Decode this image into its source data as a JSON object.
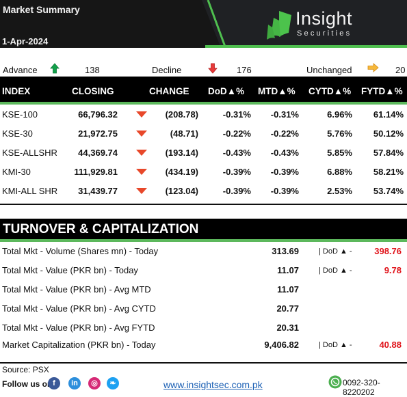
{
  "header": {
    "title": "Market Summary",
    "date": "1-Apr-2024",
    "brand_name": "Insight",
    "brand_sub": "Securities",
    "accent_color": "#4fbf4f"
  },
  "breadth": {
    "advance_label": "Advance",
    "advance_icon": "arrow-up-icon",
    "advance_value": "138",
    "decline_label": "Decline",
    "decline_icon": "arrow-down-icon",
    "decline_value": "176",
    "unchanged_label": "Unchanged",
    "unchanged_icon": "arrow-right-icon",
    "unchanged_value": "20"
  },
  "index_table": {
    "headers": [
      "INDEX",
      "CLOSING",
      "CHANGE",
      "DoD▲%",
      "MTD▲%",
      "CYTD▲%",
      "FYTD▲%"
    ],
    "rows": [
      {
        "index": "KSE-100",
        "closing": "66,796.32",
        "direction": "down",
        "change": "(208.78)",
        "dod": "-0.31%",
        "mtd": "-0.31%",
        "cytd": "6.96%",
        "fytd": "61.14%"
      },
      {
        "index": "KSE-30",
        "closing": "21,972.75",
        "direction": "down",
        "change": "(48.71)",
        "dod": "-0.22%",
        "mtd": "-0.22%",
        "cytd": "5.76%",
        "fytd": "50.12%"
      },
      {
        "index": "KSE-ALLSHR",
        "closing": "44,369.74",
        "direction": "down",
        "change": "(193.14)",
        "dod": "-0.43%",
        "mtd": "-0.43%",
        "cytd": "5.85%",
        "fytd": "57.84%"
      },
      {
        "index": "KMI-30",
        "closing": "111,929.81",
        "direction": "down",
        "change": "(434.19)",
        "dod": "-0.39%",
        "mtd": "-0.39%",
        "cytd": "6.88%",
        "fytd": "58.21%"
      },
      {
        "index": "KMI-ALL SHR",
        "closing": "31,439.77",
        "direction": "down",
        "change": "(123.04)",
        "dod": "-0.39%",
        "mtd": "-0.39%",
        "cytd": "2.53%",
        "fytd": "53.74%"
      }
    ]
  },
  "turnover": {
    "title": "TURNOVER & CAPITALIZATION",
    "rows": [
      {
        "label": "Total Mkt - Volume (Shares mn) - Today",
        "value": "313.69",
        "dod_label": "| DoD ▲  -",
        "dod_value": "398.76"
      },
      {
        "label": "Total Mkt - Value (PKR bn) - Today",
        "value": "11.07",
        "dod_label": "| DoD ▲  -",
        "dod_value": "9.78"
      },
      {
        "label": "Total Mkt - Value (PKR bn) - Avg MTD",
        "value": "11.07",
        "dod_label": "",
        "dod_value": ""
      },
      {
        "label": "Total Mkt - Value (PKR bn) - Avg CYTD",
        "value": "20.77",
        "dod_label": "",
        "dod_value": ""
      },
      {
        "label": "Total Mkt - Value (PKR bn) - Avg FYTD",
        "value": "20.31",
        "dod_label": "",
        "dod_value": ""
      },
      {
        "label": "Market Capitalization (PKR bn) - Today",
        "value": "9,406.82",
        "dod_label": "| DoD ▲  -",
        "dod_value": "40.88"
      }
    ]
  },
  "footer": {
    "source": "Source: PSX",
    "follow_label": "Follow us on",
    "social": [
      {
        "name": "facebook",
        "glyph": "f",
        "color": "#3b5998"
      },
      {
        "name": "linkedin",
        "glyph": "in",
        "color": "#2d8fdc"
      },
      {
        "name": "instagram",
        "glyph": "◎",
        "color": "#d62976"
      },
      {
        "name": "twitter",
        "glyph": "❧",
        "color": "#1da1f2"
      }
    ],
    "website": "www.insightsec.com.pk",
    "whatsapp_icon": "whatsapp-icon",
    "phone": "0092-320-8220202"
  }
}
